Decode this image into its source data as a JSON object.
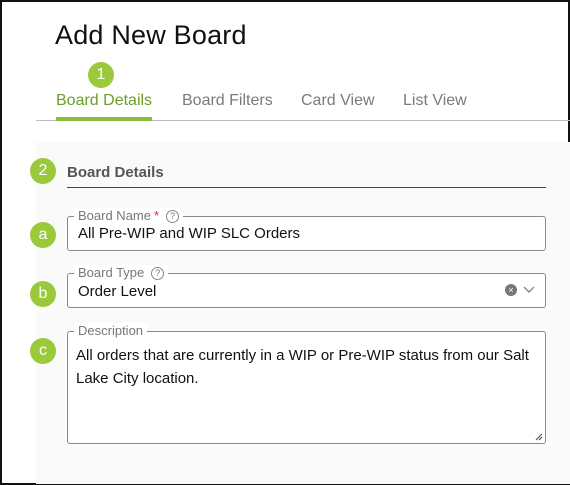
{
  "page": {
    "title": "Add New Board"
  },
  "tabs": [
    {
      "label": "Board Details",
      "active": true
    },
    {
      "label": "Board Filters",
      "active": false
    },
    {
      "label": "Card View",
      "active": false
    },
    {
      "label": "List View",
      "active": false
    }
  ],
  "callouts": {
    "step1": "1",
    "step2": "2",
    "a": "a",
    "b": "b",
    "c": "c"
  },
  "section": {
    "title": "Board Details"
  },
  "fields": {
    "board_name": {
      "label": "Board Name",
      "required_mark": "*",
      "value": "All Pre-WIP and WIP SLC Orders"
    },
    "board_type": {
      "label": "Board Type",
      "value": "Order Level"
    },
    "description": {
      "label": "Description",
      "value": "All orders that are currently in a WIP or Pre-WIP status from our Salt Lake City location."
    }
  },
  "icons": {
    "help": "?",
    "clear": "×"
  },
  "colors": {
    "accent": "#8dba3f",
    "accent_text": "#6a9e2c",
    "required": "#d32f2f"
  }
}
